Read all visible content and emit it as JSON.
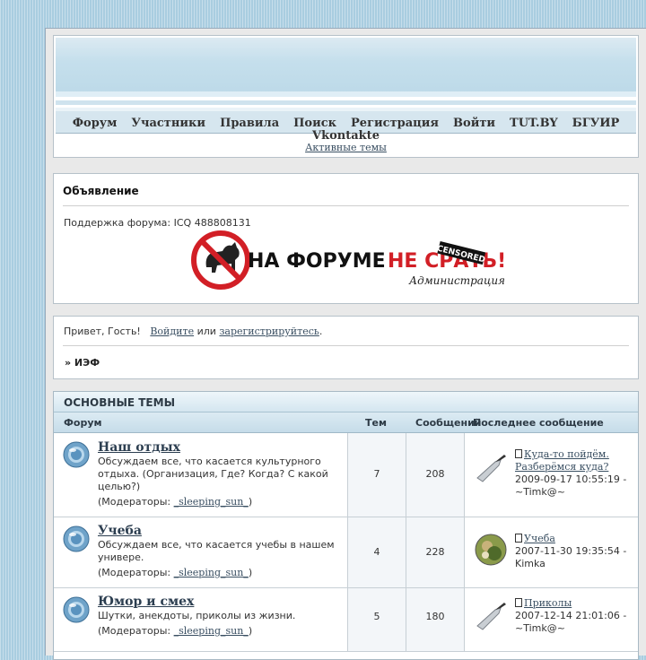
{
  "nav": {
    "items": [
      {
        "label": "Форум"
      },
      {
        "label": "Участники"
      },
      {
        "label": "Правила"
      },
      {
        "label": "Поиск"
      },
      {
        "label": "Регистрация"
      },
      {
        "label": "Войти"
      },
      {
        "label": "TUT.BY"
      },
      {
        "label": "БГУИР"
      },
      {
        "label": "Vkontakte"
      }
    ],
    "active_topics": "Активные темы"
  },
  "announcement": {
    "title": "Объявление",
    "support_text": "Поддержка форума: ICQ 488808131",
    "banner_text_black": "НА ФОРУМЕ",
    "banner_text_red": "НЕ СРАТЬ!",
    "banner_censored": "CENSORED",
    "banner_signature": "Администрация"
  },
  "greeting": {
    "hello": "Привет, Гость!",
    "login_link": "Войдите",
    "or": "или",
    "register_link": "зарегистрируйтесь",
    "period": ".",
    "breadcrumb": "» ИЭФ"
  },
  "forums": {
    "category": "ОСНОВНЫЕ ТЕМЫ",
    "columns": {
      "forum": "Форум",
      "topics": "Тем",
      "posts": "Сообщений",
      "last": "Последнее сообщение"
    },
    "rows": [
      {
        "name": "Наш отдых",
        "description": "Обсуждаем все, что касается культурного отдыха. (Организация, Где? Когда? С какой целью?)",
        "mods_prefix": "(Модераторы:",
        "mod": "_sleeping_sun_",
        "mods_suffix": ")",
        "topics": "7",
        "posts": "208",
        "last_title": "Куда-то пойдём. Разберёмся куда?",
        "last_date": "2009-09-17 10:55:19 -",
        "last_user": "~Timk@~",
        "avatar": "knife-avatar"
      },
      {
        "name": "Учеба",
        "description": "Обсуждаем все, что касается учебы в нашем универе.",
        "mods_prefix": "(Модераторы:",
        "mod": "_sleeping_sun_",
        "mods_suffix": ")",
        "topics": "4",
        "posts": "228",
        "last_title": "Учеба",
        "last_date": "2007-11-30 19:35:54 -",
        "last_user": "Kimka",
        "avatar": "photo-avatar"
      },
      {
        "name": "Юмор и смех",
        "description": "Шутки, анекдоты, приколы из жизни.",
        "mods_prefix": "(Модераторы:",
        "mod": "_sleeping_sun_",
        "mods_suffix": ")",
        "topics": "5",
        "posts": "180",
        "last_title": "Приколы",
        "last_date": "2007-12-14 21:01:06 -",
        "last_user": "~Timk@~",
        "avatar": "knife-avatar"
      }
    ]
  }
}
